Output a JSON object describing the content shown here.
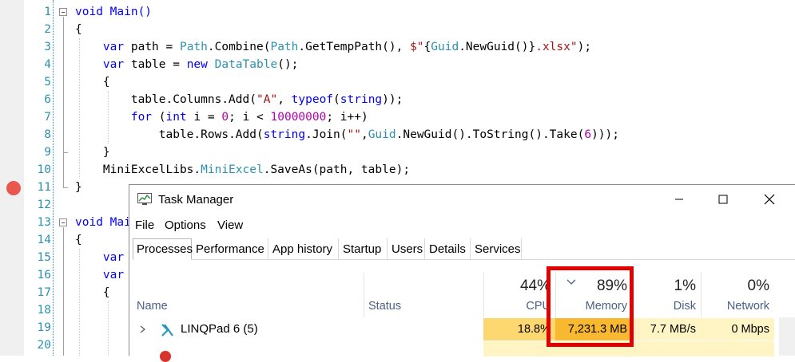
{
  "editor": {
    "line_numbers": [
      "1",
      "2",
      "3",
      "4",
      "5",
      "6",
      "7",
      "8",
      "9",
      "10",
      "11",
      "12",
      "13",
      "14",
      "15",
      "16",
      "17",
      "18",
      "19",
      "20"
    ],
    "main1_sig": "void Main()",
    "brace_open": "{",
    "brace_close": "}",
    "line3": {
      "kw": "var",
      "a": " path = ",
      "t1": "Path",
      "b": ".Combine(",
      "t2": "Path",
      "c": ".GetTempPath(), ",
      "s1": "$\"",
      "d": "{",
      "t3": "Guid",
      "e": ".NewGuid()}",
      "s2": ".xlsx\"",
      "f": ");"
    },
    "line4": {
      "kw": "var",
      "a": " table = ",
      "kw2": "new",
      "sp": " ",
      "t": "DataTable",
      "b": "();"
    },
    "line6": {
      "a": "table.Columns.Add(",
      "s": "\"A\"",
      "b": ", ",
      "kw": "typeof",
      "c": "(",
      "kw2": "string",
      "d": "));"
    },
    "line7": {
      "kw": "for",
      "a": " (",
      "kw2": "int",
      "b": " i = ",
      "n1": "0",
      "c": "; i < ",
      "n2": "10000000",
      "d": "; i++)"
    },
    "line8": {
      "a": "table.Rows.Add(",
      "kw": "string",
      "b": ".Join(",
      "s": "\"\"",
      "c": ",",
      "t": "Guid",
      "d": ".NewGuid().ToString().Take(",
      "n": "6",
      "e": ")));"
    },
    "line10": {
      "a": "MiniExcelLibs.",
      "t": "MiniExcel",
      "b": ".SaveAs(path, table);"
    },
    "main2_sig": "void Mai",
    "line15_kw": "var",
    "line16_kw": "var"
  },
  "task_manager": {
    "title": "Task Manager",
    "menu": [
      "File",
      "Options",
      "View"
    ],
    "tabs": [
      "Processes",
      "Performance",
      "App history",
      "Startup",
      "Users",
      "Details",
      "Services"
    ],
    "active_tab": "Processes",
    "columns": {
      "name": "Name",
      "status": "Status",
      "cpu": {
        "pct": "44%",
        "label": "CPU"
      },
      "memory": {
        "pct": "89%",
        "label": "Memory"
      },
      "disk": {
        "pct": "1%",
        "label": "Disk"
      },
      "network": {
        "pct": "0%",
        "label": "Network"
      }
    },
    "rows": [
      {
        "name": "LINQPad 6 (5)",
        "cpu": "18.8%",
        "memory": "7,231.3 MB",
        "disk": "7.7 MB/s",
        "network": "0 Mbps"
      }
    ],
    "colors": {
      "cpu_cell": "#fdd770",
      "memory_cell": "#f8b830",
      "light_cell": "#fff4c4",
      "highlight": "#e00000",
      "breakpoint": "#e8584e"
    }
  }
}
